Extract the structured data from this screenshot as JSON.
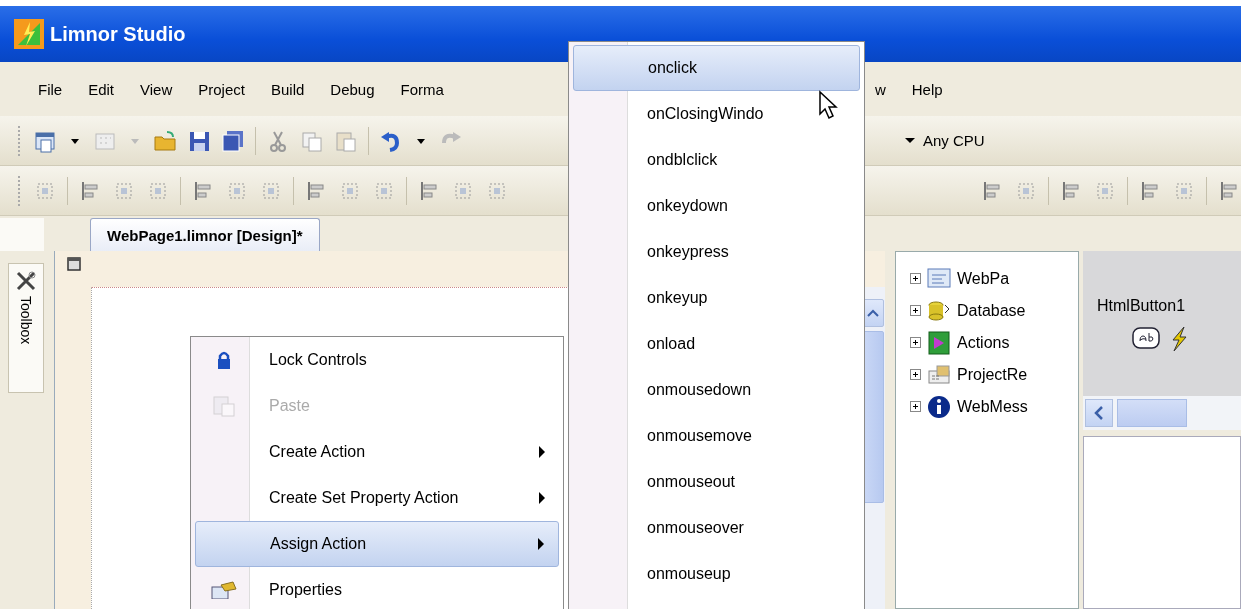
{
  "window": {
    "title": "Limnor Studio"
  },
  "menu_bar": [
    "File",
    "Edit",
    "View",
    "Project",
    "Build",
    "Debug",
    "Forma",
    "w",
    "Help"
  ],
  "toolbar": {
    "platform": "Any CPU"
  },
  "document_tab": {
    "label": "WebPage1.limnor [Design]*",
    "selected": true
  },
  "toolbox_tab": {
    "label": "Toolbox"
  },
  "project_tree": [
    {
      "label": "WebPa",
      "expanded": false
    },
    {
      "label": "Database",
      "expanded": false
    },
    {
      "label": "Actions",
      "expanded": false
    },
    {
      "label": "ProjectRe",
      "expanded": false
    },
    {
      "label": "WebMess",
      "expanded": false
    }
  ],
  "component_panel": {
    "name": "HtmlButton1"
  },
  "context_menu": [
    {
      "label": "Lock Controls",
      "disabled": false,
      "submenu": false,
      "selected": false
    },
    {
      "label": "Paste",
      "disabled": true,
      "submenu": false,
      "selected": false
    },
    {
      "label": "Create Action",
      "disabled": false,
      "submenu": true,
      "selected": false
    },
    {
      "label": "Create Set Property Action",
      "disabled": false,
      "submenu": true,
      "selected": false
    },
    {
      "label": "Assign Action",
      "disabled": false,
      "submenu": true,
      "selected": true
    },
    {
      "label": "Properties",
      "disabled": false,
      "submenu": false,
      "selected": false
    }
  ],
  "event_menu": [
    {
      "label": "onclick",
      "selected": true
    },
    {
      "label": "onClosingWindo",
      "selected": false
    },
    {
      "label": "ondblclick",
      "selected": false
    },
    {
      "label": "onkeydown",
      "selected": false
    },
    {
      "label": "onkeypress",
      "selected": false
    },
    {
      "label": "onkeyup",
      "selected": false
    },
    {
      "label": "onload",
      "selected": false
    },
    {
      "label": "onmousedown",
      "selected": false
    },
    {
      "label": "onmousemove",
      "selected": false
    },
    {
      "label": "onmouseout",
      "selected": false
    },
    {
      "label": "onmouseover",
      "selected": false
    },
    {
      "label": "onmouseup",
      "selected": false
    }
  ]
}
